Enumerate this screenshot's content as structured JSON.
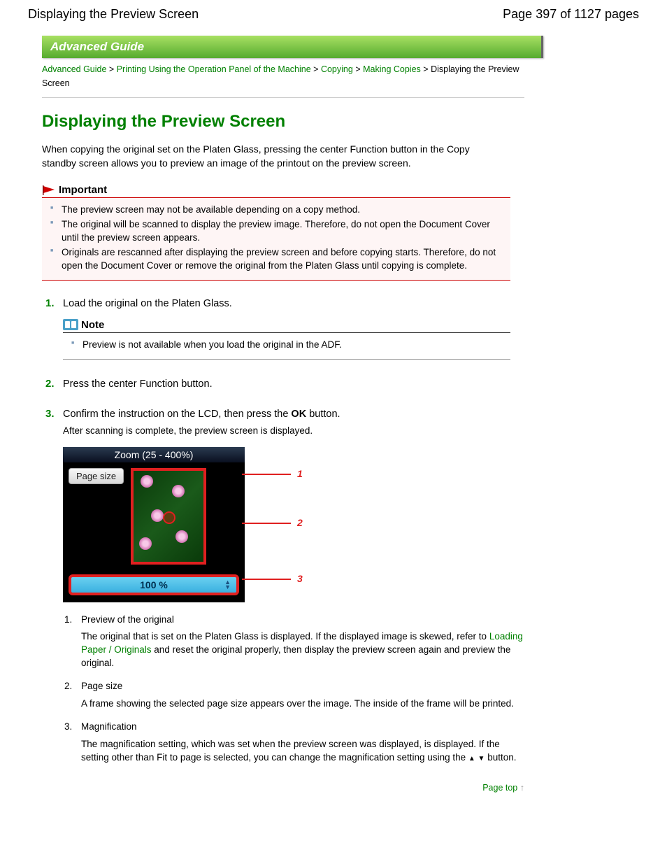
{
  "header": {
    "title": "Displaying the Preview Screen",
    "page_info": "Page 397 of 1127 pages"
  },
  "banner": "Advanced Guide",
  "breadcrumb": {
    "items": [
      "Advanced Guide",
      "Printing Using the Operation Panel of the Machine",
      "Copying",
      "Making Copies"
    ],
    "current": "Displaying the Preview Screen",
    "sep": ">"
  },
  "title": "Displaying the Preview Screen",
  "intro": "When copying the original set on the Platen Glass, pressing the center Function button in the Copy standby screen allows you to preview an image of the printout on the preview screen.",
  "important": {
    "label": "Important",
    "items": [
      "The preview screen may not be available depending on a copy method.",
      "The original will be scanned to display the preview image. Therefore, do not open the Document Cover until the preview screen appears.",
      "Originals are rescanned after displaying the preview screen and before copying starts. Therefore, do not open the Document Cover or remove the original from the Platen Glass until copying is complete."
    ]
  },
  "steps": {
    "s1": {
      "num": "1.",
      "text": "Load the original on the Platen Glass.",
      "note_label": "Note",
      "note_item": "Preview is not available when you load the original in the ADF."
    },
    "s2": {
      "num": "2.",
      "text": "Press the center Function button."
    },
    "s3": {
      "num": "3.",
      "text_a": "Confirm the instruction on the LCD, then press the ",
      "ok": "OK",
      "text_b": " button.",
      "sub": "After scanning is complete, the preview screen is displayed."
    }
  },
  "lcd": {
    "zoom_title": "Zoom (25 - 400%)",
    "page_size": "Page size",
    "zoom_value": "100 %",
    "c1": "1",
    "c2": "2",
    "c3": "3"
  },
  "sublist": {
    "i1": {
      "num": "1.",
      "title": "Preview of the original",
      "desc_a": "The original that is set on the Platen Glass is displayed. If the displayed image is skewed, refer to ",
      "link": "Loading Paper / Originals",
      "desc_b": " and reset the original properly, then display the preview screen again and preview the original."
    },
    "i2": {
      "num": "2.",
      "title": "Page size",
      "desc": "A frame showing the selected page size appears over the image. The inside of the frame will be printed."
    },
    "i3": {
      "num": "3.",
      "title": "Magnification",
      "desc_a": "The magnification setting, which was set when the preview screen was displayed, is displayed. If the setting other than Fit to page is selected, you can change the magnification setting using the ",
      "desc_b": " button."
    }
  },
  "page_top": "Page top"
}
